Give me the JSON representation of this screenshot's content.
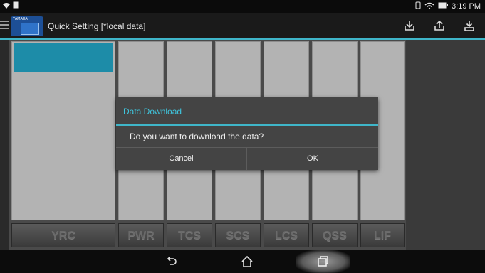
{
  "status_bar": {
    "time": "3:19 PM"
  },
  "app_bar": {
    "title": "Quick Setting  [*local data]",
    "logo_brand": "YAMAHA"
  },
  "tabs": [
    "YRC",
    "PWR",
    "TCS",
    "SCS",
    "LCS",
    "QSS",
    "LIF"
  ],
  "dialog": {
    "title": "Data Download",
    "message": "Do you want to download the data?",
    "cancel_label": "Cancel",
    "ok_label": "OK"
  },
  "colors": {
    "accent": "#3fb6c9",
    "selected_cell": "#1d8ca8",
    "dialog_title": "#3fc4dc"
  }
}
